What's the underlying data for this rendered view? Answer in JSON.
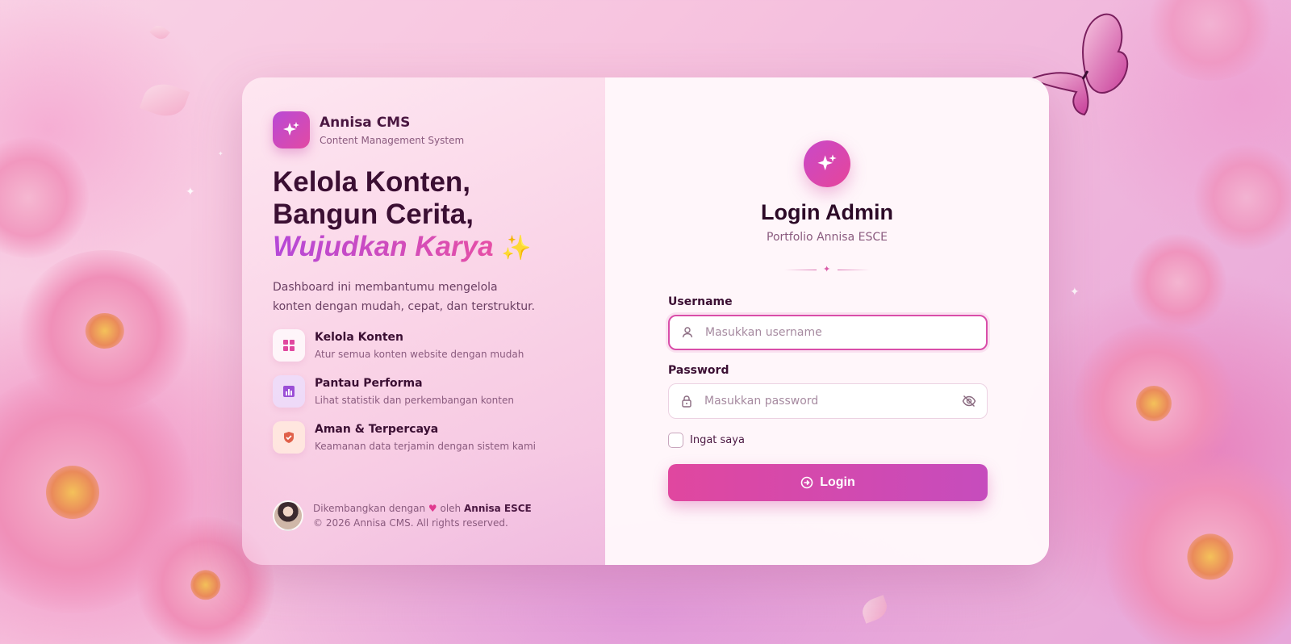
{
  "brand": {
    "name": "Annisa CMS",
    "subtitle": "Content Management System",
    "logo_icon": "sparkles-icon"
  },
  "hero": {
    "line1": "Kelola Konten,",
    "line2": "Bangun Cerita,",
    "line3_accent": "Wujudkan Karya",
    "emoji": "✨",
    "description": "Dashboard ini membantumu mengelola konten dengan mudah, cepat, dan terstruktur."
  },
  "features": [
    {
      "title": "Kelola Konten",
      "subtitle": "Atur semua konten website dengan mudah",
      "icon": "grid-icon",
      "color": "#e0479f"
    },
    {
      "title": "Pantau Performa",
      "subtitle": "Lihat statistik dan perkembangan konten",
      "icon": "chart-icon",
      "color": "#9b4fd6"
    },
    {
      "title": "Aman & Terpercaya",
      "subtitle": "Keamanan data terjamin dengan sistem kami",
      "icon": "shield-icon",
      "color": "#e0604a"
    }
  ],
  "footer": {
    "developed_prefix": "Dikembangkan dengan",
    "heart": "♥",
    "by": "oleh",
    "author": "Annisa ESCE",
    "copyright": "© 2026 Annisa CMS. All rights reserved."
  },
  "login": {
    "title": "Login Admin",
    "subtitle": "Portfolio Annisa ESCE",
    "divider_symbol": "✦",
    "username_label": "Username",
    "username_placeholder": "Masukkan username",
    "password_label": "Password",
    "password_placeholder": "Masukkan password",
    "remember_label": "Ingat saya",
    "button_label": "Login",
    "button_icon": "login-arrow-icon"
  },
  "colors": {
    "accent": "#d94ea9",
    "accent_purple": "#b548d8",
    "heading": "#2c0a27"
  }
}
